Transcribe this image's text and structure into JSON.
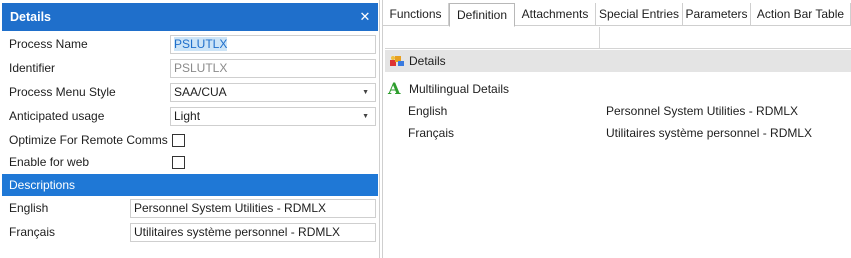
{
  "left_panel": {
    "title": "Details",
    "close_glyph": "✕",
    "fields": {
      "process_name": {
        "label": "Process Name",
        "value": "PSLUTLX"
      },
      "identifier": {
        "label": "Identifier",
        "value": "PSLUTLX"
      },
      "process_menu_style": {
        "label": "Process Menu Style",
        "value": "SAA/CUA"
      },
      "anticipated_usage": {
        "label": "Anticipated usage",
        "value": "Light"
      },
      "optimize_remote": {
        "label": "Optimize For Remote Comms",
        "checked": false
      },
      "enable_web": {
        "label": "Enable for web",
        "checked": false
      }
    },
    "descriptions_header": "Descriptions",
    "descriptions": {
      "english": {
        "label": "English",
        "value": "Personnel System Utilities - RDMLX"
      },
      "francais": {
        "label": "Français",
        "value": "Utilitaires système personnel - RDMLX"
      }
    },
    "dropdown_glyph": "▼"
  },
  "right_panel": {
    "tabs": [
      {
        "label": "Functions",
        "active": false
      },
      {
        "label": "Definition",
        "active": true
      },
      {
        "label": "Attachments",
        "active": false
      },
      {
        "label": "Special Entries",
        "active": false
      },
      {
        "label": "Parameters",
        "active": false
      },
      {
        "label": "Action Bar Table",
        "active": false
      }
    ],
    "details_group": {
      "label": "Details",
      "icon": "details-puzzle-icon"
    },
    "multilingual_group": {
      "label": "Multilingual Details",
      "icon": "multilingual-a-icon",
      "glyph": "A"
    },
    "languages": [
      {
        "language": "English",
        "description": "Personnel System Utilities - RDMLX"
      },
      {
        "language": "Français",
        "description": "Utilitaires système personnel - RDMLX"
      }
    ]
  },
  "colors": {
    "header_blue": "#1f6fcb",
    "band_blue": "#1f78d6",
    "selection_highlight": "#cce4f7",
    "group_row_gray": "#e4e4e4",
    "multilingual_green": "#2e9e2e"
  }
}
